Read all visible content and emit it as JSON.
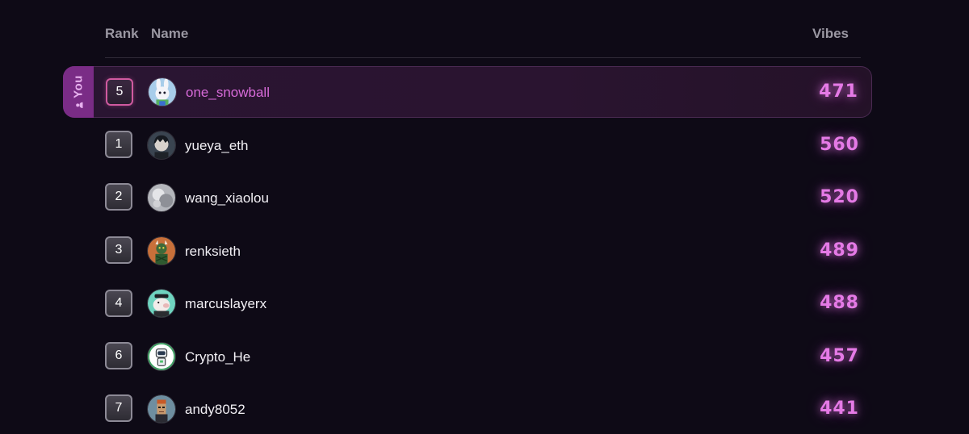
{
  "header": {
    "rank_label": "Rank",
    "name_label": "Name",
    "vibes_label": "Vibes"
  },
  "you_row": {
    "tab_label": "You",
    "rank": "5",
    "name": "one_snowball",
    "vibes": "471",
    "avatar": "bunny-avatar"
  },
  "rows": [
    {
      "rank": "1",
      "name": "yueya_eth",
      "vibes": "560",
      "avatar": "anime-dark-hair-avatar"
    },
    {
      "rank": "2",
      "name": "wang_xiaolou",
      "vibes": "520",
      "avatar": "grayscale-avatar"
    },
    {
      "rank": "3",
      "name": "renksieth",
      "vibes": "489",
      "avatar": "green-creature-avatar"
    },
    {
      "rank": "4",
      "name": "marcuslayerx",
      "vibes": "488",
      "avatar": "pig-avatar"
    },
    {
      "rank": "6",
      "name": "Crypto_He",
      "vibes": "457",
      "avatar": "astronaut-avatar"
    },
    {
      "rank": "7",
      "name": "andy8052",
      "vibes": "441",
      "avatar": "pixel-punk-avatar"
    }
  ],
  "colors": {
    "background": "#0e0a16",
    "accent": "#e57ae6",
    "you_tab": "#7a2c86",
    "you_highlight": "#2a1532"
  }
}
